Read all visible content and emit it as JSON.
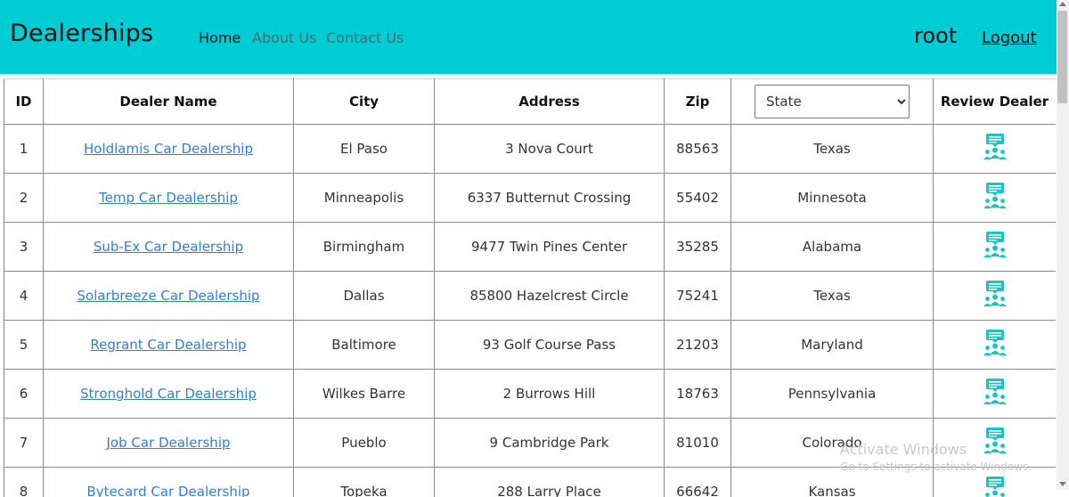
{
  "navbar": {
    "brand": "Dealerships",
    "links": [
      "Home",
      "About Us",
      "Contact Us"
    ],
    "user": "root",
    "logout": "Logout",
    "colors": {
      "background": "#00cdd3"
    }
  },
  "table": {
    "headers": {
      "id": "ID",
      "dealer_name": "Dealer Name",
      "city": "City",
      "address": "Address",
      "zip": "Zip",
      "review": "Review Dealer"
    },
    "state_filter": {
      "selected": "State"
    },
    "review_icon": "review-dealer-icon",
    "rows": [
      {
        "id": "1",
        "name": "Holdlamis Car Dealership",
        "city": "El Paso",
        "address": "3 Nova Court",
        "zip": "88563",
        "state": "Texas"
      },
      {
        "id": "2",
        "name": "Temp Car Dealership",
        "city": "Minneapolis",
        "address": "6337 Butternut Crossing",
        "zip": "55402",
        "state": "Minnesota"
      },
      {
        "id": "3",
        "name": "Sub-Ex Car Dealership",
        "city": "Birmingham",
        "address": "9477 Twin Pines Center",
        "zip": "35285",
        "state": "Alabama"
      },
      {
        "id": "4",
        "name": "Solarbreeze Car Dealership",
        "city": "Dallas",
        "address": "85800 Hazelcrest Circle",
        "zip": "75241",
        "state": "Texas"
      },
      {
        "id": "5",
        "name": "Regrant Car Dealership",
        "city": "Baltimore",
        "address": "93 Golf Course Pass",
        "zip": "21203",
        "state": "Maryland"
      },
      {
        "id": "6",
        "name": "Stronghold Car Dealership",
        "city": "Wilkes Barre",
        "address": "2 Burrows Hill",
        "zip": "18763",
        "state": "Pennsylvania"
      },
      {
        "id": "7",
        "name": "Job Car Dealership",
        "city": "Pueblo",
        "address": "9 Cambridge Park",
        "zip": "81010",
        "state": "Colorado"
      },
      {
        "id": "8",
        "name": "Bytecard Car Dealership",
        "city": "Topeka",
        "address": "288 Larry Place",
        "zip": "66642",
        "state": "Kansas"
      }
    ]
  },
  "watermark": {
    "title": "Activate Windows",
    "subtitle": "Go to Settings to activate Windows."
  }
}
